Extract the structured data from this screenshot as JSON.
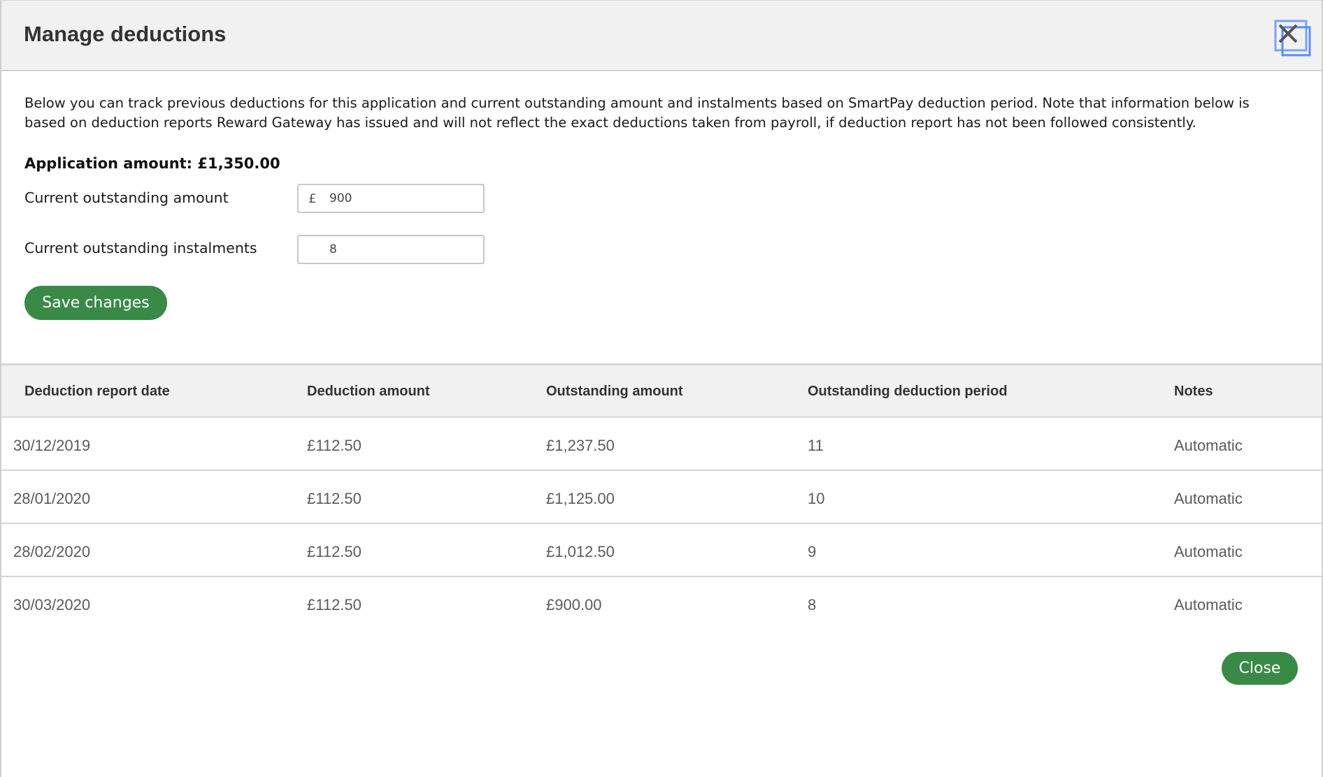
{
  "header": {
    "title": "Manage deductions",
    "close_icon": "close-icon"
  },
  "description": "Below you can track previous deductions for this application and current outstanding amount and instalments based on SmartPay deduction period. Note that information below is based on deduction reports Reward Gateway has issued and will not reflect the exact deductions taken from payroll, if deduction report has not been followed consistently.",
  "application_amount": "Application amount: £1,350.00",
  "fields": {
    "outstanding_amount": {
      "label": "Current outstanding amount",
      "prefix": "£",
      "value": "900"
    },
    "outstanding_instalments": {
      "label": "Current outstanding instalments",
      "value": "8"
    }
  },
  "buttons": {
    "save": "Save changes",
    "close": "Close"
  },
  "table": {
    "headers": [
      "Deduction report date",
      "Deduction amount",
      "Outstanding amount",
      "Outstanding deduction period",
      "Notes"
    ],
    "rows": [
      [
        "30/12/2019",
        "£112.50",
        "£1,237.50",
        "11",
        "Automatic"
      ],
      [
        "28/01/2020",
        "£112.50",
        "£1,125.00",
        "10",
        "Automatic"
      ],
      [
        "28/02/2020",
        "£112.50",
        "£1,012.50",
        "9",
        "Automatic"
      ],
      [
        "30/03/2020",
        "£112.50",
        "£900.00",
        "8",
        "Automatic"
      ]
    ]
  },
  "colors": {
    "accent_green": "#3a8a47",
    "header_bg": "#f1f1f1",
    "close_icon_outline": "#5b8def"
  }
}
